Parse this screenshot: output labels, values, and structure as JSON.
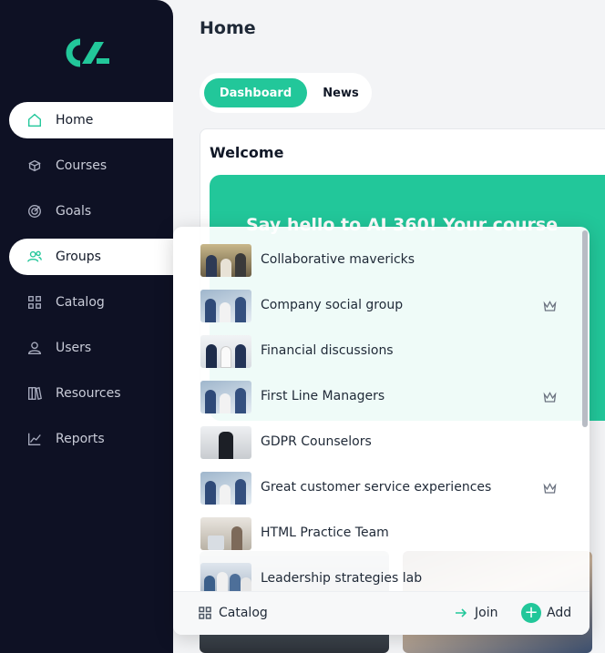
{
  "colors": {
    "accent": "#22c79a",
    "sidebar_bg": "#0e1124"
  },
  "sidebar": {
    "items": [
      {
        "label": "Home",
        "icon": "home-icon",
        "active": true
      },
      {
        "label": "Courses",
        "icon": "courses-icon"
      },
      {
        "label": "Goals",
        "icon": "goals-icon"
      },
      {
        "label": "Groups",
        "icon": "groups-icon",
        "active": true
      },
      {
        "label": "Catalog",
        "icon": "catalog-icon"
      },
      {
        "label": "Users",
        "icon": "user-icon"
      },
      {
        "label": "Resources",
        "icon": "resources-icon"
      },
      {
        "label": "Reports",
        "icon": "reports-icon"
      }
    ]
  },
  "main": {
    "title": "Home",
    "tabs": [
      {
        "label": "Dashboard",
        "active": true
      },
      {
        "label": "News"
      }
    ],
    "welcome": {
      "title": "Welcome",
      "banner_text": "Say hello to AI 360! Your course"
    }
  },
  "groups_menu": {
    "items": [
      {
        "name": "Collaborative mavericks",
        "owner": false
      },
      {
        "name": "Company social group",
        "owner": true
      },
      {
        "name": "Financial discussions",
        "owner": false
      },
      {
        "name": "First Line Managers",
        "owner": true
      },
      {
        "name": "GDPR Counselors",
        "owner": false
      },
      {
        "name": "Great customer service experiences",
        "owner": true
      },
      {
        "name": "HTML Practice Team",
        "owner": false
      },
      {
        "name": "Leadership strategies lab",
        "owner": false
      }
    ],
    "footer": {
      "catalog_label": "Catalog",
      "join_label": "Join",
      "add_label": "Add"
    }
  }
}
